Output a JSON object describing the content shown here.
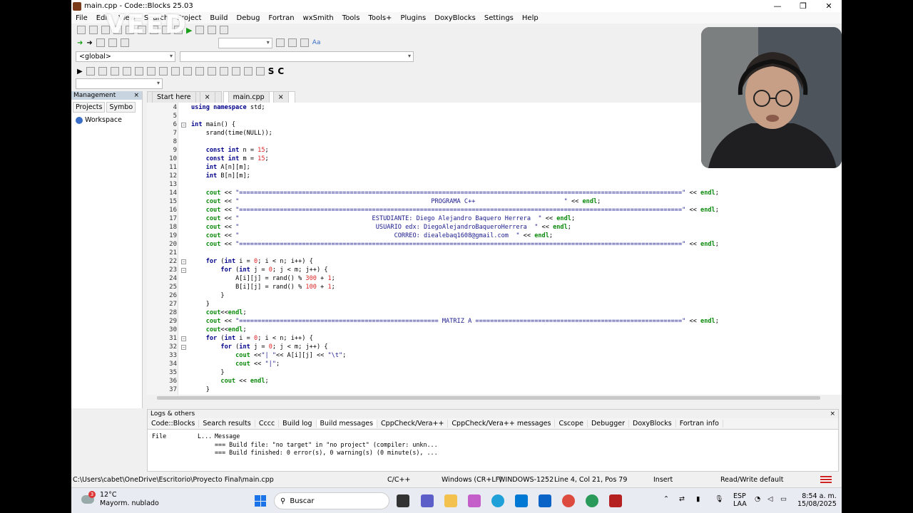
{
  "window": {
    "title": "main.cpp - Code::Blocks 25.03",
    "min": "—",
    "max": "❐",
    "close": "✕"
  },
  "menu": [
    "File",
    "Edit",
    "View",
    "Search",
    "Project",
    "Build",
    "Debug",
    "Fortran",
    "wxSmith",
    "Tools",
    "Tools+",
    "Plugins",
    "DoxyBlocks",
    "Settings",
    "Help"
  ],
  "watermark": "VEED",
  "scope_combo": "<global>",
  "management": {
    "title": "Management",
    "close": "×",
    "tab_projects": "Projects",
    "tab_symbols": "Symbo",
    "workspace": "Workspace"
  },
  "editor_tabs": [
    {
      "label": "Start here",
      "close": "×"
    },
    {
      "label": "main.cpp",
      "close": "×"
    }
  ],
  "code_lines": [
    {
      "n": "4",
      "t": "using namespace std;"
    },
    {
      "n": "5",
      "t": ""
    },
    {
      "n": "6",
      "t": "int main() {"
    },
    {
      "n": "7",
      "t": "    srand(time(NULL));"
    },
    {
      "n": "8",
      "t": ""
    },
    {
      "n": "9",
      "t": "    const int n = 15;"
    },
    {
      "n": "10",
      "t": "    const int m = 15;"
    },
    {
      "n": "11",
      "t": "    int A[n][m];"
    },
    {
      "n": "12",
      "t": "    int B[n][m];"
    },
    {
      "n": "13",
      "t": ""
    },
    {
      "n": "14",
      "t": "    cout << \"========================================================================================================================\" << endl;"
    },
    {
      "n": "15",
      "t": "    cout << \"                                                    PROGRAMA C++                        \" << endl;"
    },
    {
      "n": "16",
      "t": "    cout << \"========================================================================================================================\" << endl;"
    },
    {
      "n": "17",
      "t": "    cout << \"                                    ESTUDIANTE: Diego Alejandro Baquero Herrera  \" << endl;"
    },
    {
      "n": "18",
      "t": "    cout << \"                                     USUARIO edx: DiegoAlejandroBaqueroHerrera  \" << endl;"
    },
    {
      "n": "19",
      "t": "    cout << \"                                          CORREO: diealebaq1608@gmail.com  \" << endl;"
    },
    {
      "n": "20",
      "t": "    cout << \"========================================================================================================================\" << endl;"
    },
    {
      "n": "21",
      "t": ""
    },
    {
      "n": "22",
      "t": "    for (int i = 0; i < n; i++) {"
    },
    {
      "n": "23",
      "t": "        for (int j = 0; j < m; j++) {"
    },
    {
      "n": "24",
      "t": "            A[i][j] = rand() % 300 + 1;"
    },
    {
      "n": "25",
      "t": "            B[i][j] = rand() % 100 + 1;"
    },
    {
      "n": "26",
      "t": "        }"
    },
    {
      "n": "27",
      "t": "    }"
    },
    {
      "n": "28",
      "t": "    cout<<endl;"
    },
    {
      "n": "29",
      "t": "    cout << \"====================================================== MATRIZ A ========================================================\" << endl;"
    },
    {
      "n": "30",
      "t": "    cout<<endl;"
    },
    {
      "n": "31",
      "t": "    for (int i = 0; i < n; i++) {"
    },
    {
      "n": "32",
      "t": "        for (int j = 0; j < m; j++) {"
    },
    {
      "n": "33",
      "t": "            cout <<\"| \"<< A[i][j] << \"\\t\";"
    },
    {
      "n": "34",
      "t": "            cout << \"|\";"
    },
    {
      "n": "35",
      "t": "        }"
    },
    {
      "n": "36",
      "t": "        cout << endl;"
    },
    {
      "n": "37",
      "t": "    }"
    }
  ],
  "logs": {
    "title": "Logs & others",
    "close": "×",
    "tabs": [
      "Code::Blocks",
      "Search results",
      "Cccc",
      "Build log",
      "Build messages",
      "CppCheck/Vera++",
      "CppCheck/Vera++ messages",
      "Cscope",
      "Debugger",
      "DoxyBlocks",
      "Fortran info"
    ],
    "col_file": "File",
    "col_line": "L...",
    "col_message": "Message",
    "rows": [
      "=== Build file: \"no target\" in \"no project\" (compiler: unkn...",
      "=== Build finished: 0 error(s), 0 warning(s) (0 minute(s), ..."
    ]
  },
  "status": {
    "path": "C:\\Users\\cabet\\OneDrive\\Escritorio\\Proyecto Final\\main.cpp",
    "lang": "C/C++",
    "eol": "Windows (CR+LF)",
    "enc": "WINDOWS-1252",
    "pos": "Line 4, Col 21, Pos 79",
    "mode": "Insert",
    "rw": "Read/Write",
    "profile": "default"
  },
  "taskbar": {
    "temp": "12°C",
    "weather": "Mayorm. nublado",
    "badge": "3",
    "search": "Buscar",
    "lang1": "ESP",
    "lang2": "LAA",
    "time": "8:54 a. m.",
    "date": "15/08/2025"
  }
}
